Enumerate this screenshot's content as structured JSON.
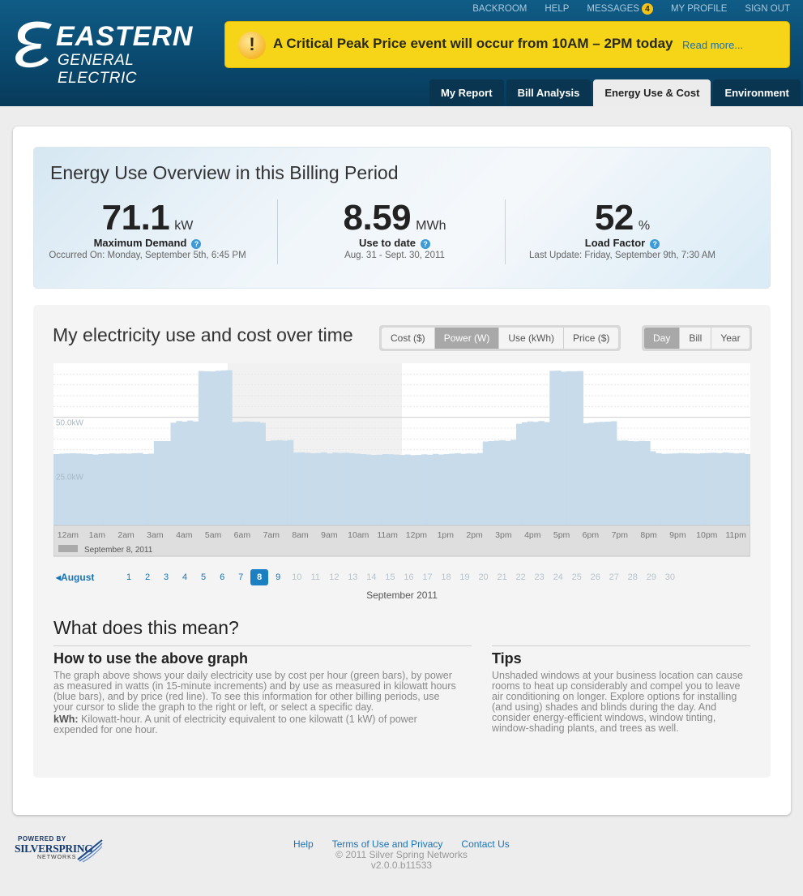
{
  "brand": {
    "name_line1": "EASTERN",
    "name_line2": "GENERAL ELECTRIC",
    "colors": {
      "header": "#0a4a70",
      "accent": "#1a74b5",
      "alert": "#f6d417"
    }
  },
  "topnav": {
    "backroom": "BACKROOM",
    "help": "HELP",
    "messages": "MESSAGES",
    "messages_count": "4",
    "profile": "MY PROFILE",
    "signout": "SIGN OUT"
  },
  "alert": {
    "icon": "warning-icon",
    "text": "A Critical Peak Price event will occur from 10AM – 2PM today",
    "link": "Read more..."
  },
  "tabs": [
    {
      "label": "My Report"
    },
    {
      "label": "Bill Analysis"
    },
    {
      "label": "Energy Use & Cost",
      "active": true
    },
    {
      "label": "Environment"
    }
  ],
  "overview": {
    "title": "Energy Use Overview in this Billing Period",
    "stats": [
      {
        "value": "71.1",
        "unit": "kW",
        "label": "Maximum Demand",
        "sub": "Occurred On: Monday, September 5th, 6:45 PM"
      },
      {
        "value": "8.59",
        "unit": "MWh",
        "label": "Use to date",
        "sub": "Aug. 31 - Sept. 30, 2011"
      },
      {
        "value": "52",
        "unit": "%",
        "label": "Load Factor",
        "sub": "Last Update: Friday, September 9th, 7:30 AM"
      }
    ]
  },
  "chart_section": {
    "title": "My electricity use and cost over time",
    "metric_buttons": [
      {
        "label": "Cost ($)"
      },
      {
        "label": "Power (W)",
        "active": true
      },
      {
        "label": "Use (kWh)"
      },
      {
        "label": "Price ($)"
      }
    ],
    "range_buttons": [
      {
        "label": "Day",
        "active": true
      },
      {
        "label": "Bill"
      },
      {
        "label": "Year"
      }
    ],
    "slider_date": "September 8, 2011"
  },
  "chart_data": {
    "type": "bar",
    "series": [
      {
        "values": [
          33,
          33.2,
          33.3,
          33.4,
          33.3,
          33.2,
          33,
          32.8,
          33,
          33.1,
          33.3,
          33.2,
          33.3,
          33.2,
          33.4,
          33.5,
          33,
          33.2,
          39,
          39,
          39,
          47.5,
          48.3,
          48,
          48.5,
          48.1,
          71.4,
          71.3,
          71.2,
          71.5,
          71.7,
          71.8,
          47.8,
          47.9,
          48.1,
          48,
          47.9,
          47.5,
          39,
          39.3,
          39.4,
          39.2,
          39.5,
          33.7,
          33.8,
          33.6,
          33.4,
          33.5,
          33.8,
          33.3,
          33.7,
          33.5,
          33.6,
          33.4,
          33.2,
          33,
          32.8,
          32.6,
          32.7,
          33,
          32.9,
          32.8,
          32.6,
          32.8,
          32.5,
          32.6,
          32.9,
          32.7,
          33.1,
          32.8,
          33,
          33.2,
          33.4,
          33.1,
          33.3,
          33.2,
          33.5,
          38.8,
          39,
          39.2,
          39.4,
          39.1,
          39.6,
          47,
          47.7,
          48.1,
          47.9,
          48.3,
          47.8,
          71.5,
          71.6,
          71.1,
          71.3,
          71.3,
          71.4,
          47.2,
          47.5,
          47.8,
          47.9,
          48,
          48.2,
          39.2,
          39.3,
          39,
          38.9,
          39.1,
          39,
          34.3,
          33.4,
          33.1,
          33.2,
          33.3,
          33.5,
          33.4,
          33.3,
          33.2,
          33.4,
          33.5,
          33.6,
          33.4,
          33.7,
          33.5,
          33.3,
          33.5,
          33
        ]
      }
    ],
    "x_ticks": [
      "12am",
      "1am",
      "2am",
      "3am",
      "4am",
      "5am",
      "6am",
      "7am",
      "8am",
      "9am",
      "10am",
      "11am",
      "12pm",
      "1pm",
      "2pm",
      "3pm",
      "4pm",
      "5pm",
      "6pm",
      "7pm",
      "8pm",
      "9pm",
      "10pm",
      "11pm"
    ],
    "y_ticks": [
      {
        "value": 25,
        "label": "25.0kW"
      },
      {
        "value": 50,
        "label": "50.0kW"
      }
    ],
    "ylim": [
      0,
      75
    ],
    "highlight_hours": [
      6,
      12
    ],
    "grid": true
  },
  "pager": {
    "prev_month": "August",
    "days": [
      "1",
      "2",
      "3",
      "4",
      "5",
      "6",
      "7",
      "8",
      "9",
      "10",
      "11",
      "12",
      "13",
      "14",
      "15",
      "16",
      "17",
      "18",
      "19",
      "20",
      "21",
      "22",
      "23",
      "24",
      "25",
      "26",
      "27",
      "28",
      "29",
      "30"
    ],
    "selected_day": 8,
    "month_year": "September 2011"
  },
  "help": {
    "title": "What does this mean?",
    "graph_title": "How to use the above graph",
    "graph_body": "The graph above shows your daily electricity use by cost per hour (green bars), by power as measured in watts (in 15-minute increments) and by use as measured in kilowatt hours (blue bars), and by price (red line). To see this information for other billing periods, use your cursor to slide the graph to the right or left, or select a specific day.",
    "kwh_term": "kWh:",
    "kwh_def": " Kilowatt-hour. A unit of electricity equivalent to one kilowatt (1 kW) of power expended for one hour.",
    "tips_title": "Tips",
    "tips_body": "Unshaded windows at your business location can cause rooms to heat up considerably and compel you to leave air conditioning on longer. Explore options for installing (and using) shades and blinds during the day. And consider energy-efficient windows, window tinting, window-shading plants, and trees as well."
  },
  "footer": {
    "powered_by": "POWERED BY",
    "partner": "SILVERSPRING",
    "partner_sub": "NETWORKS",
    "links": [
      "Help",
      "Terms of Use and Privacy",
      "Contact Us"
    ],
    "copyright": "© 2011 Silver Spring Networks",
    "version": "v2.0.0.b11533"
  }
}
